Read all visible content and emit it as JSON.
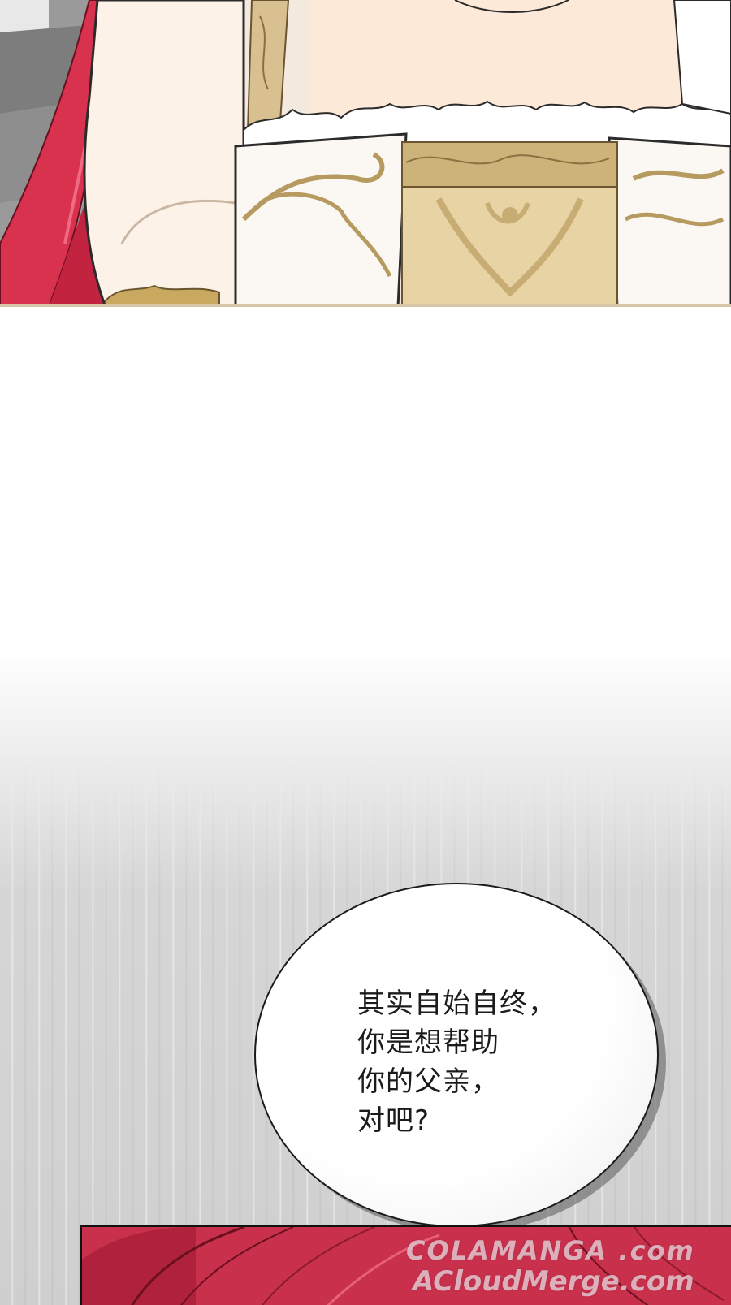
{
  "speech_bubble": {
    "lines": [
      "其实自始自终，",
      "你是想帮助",
      "你的父亲，",
      "对吧?"
    ]
  },
  "watermark": {
    "line1": "COLAMANGA .com",
    "line2": "ACloudMerge.com"
  }
}
